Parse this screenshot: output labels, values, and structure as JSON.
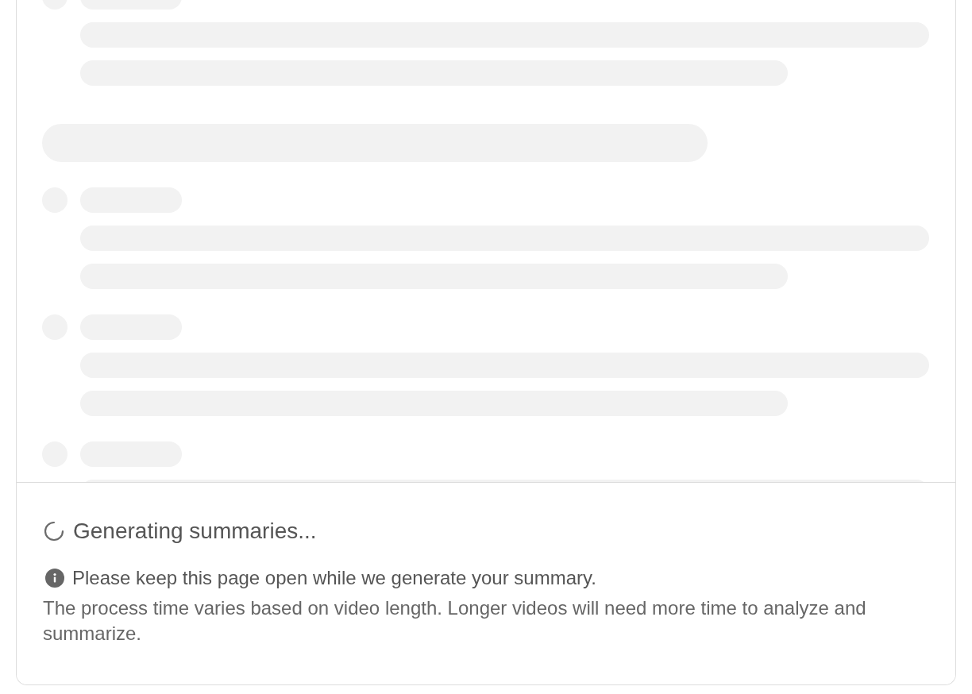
{
  "status": {
    "message": "Generating summaries..."
  },
  "notice": {
    "text": "Please keep this page open while we generate your summary."
  },
  "description": "The process time varies based on video length. Longer videos will need more time to analyze and summarize."
}
